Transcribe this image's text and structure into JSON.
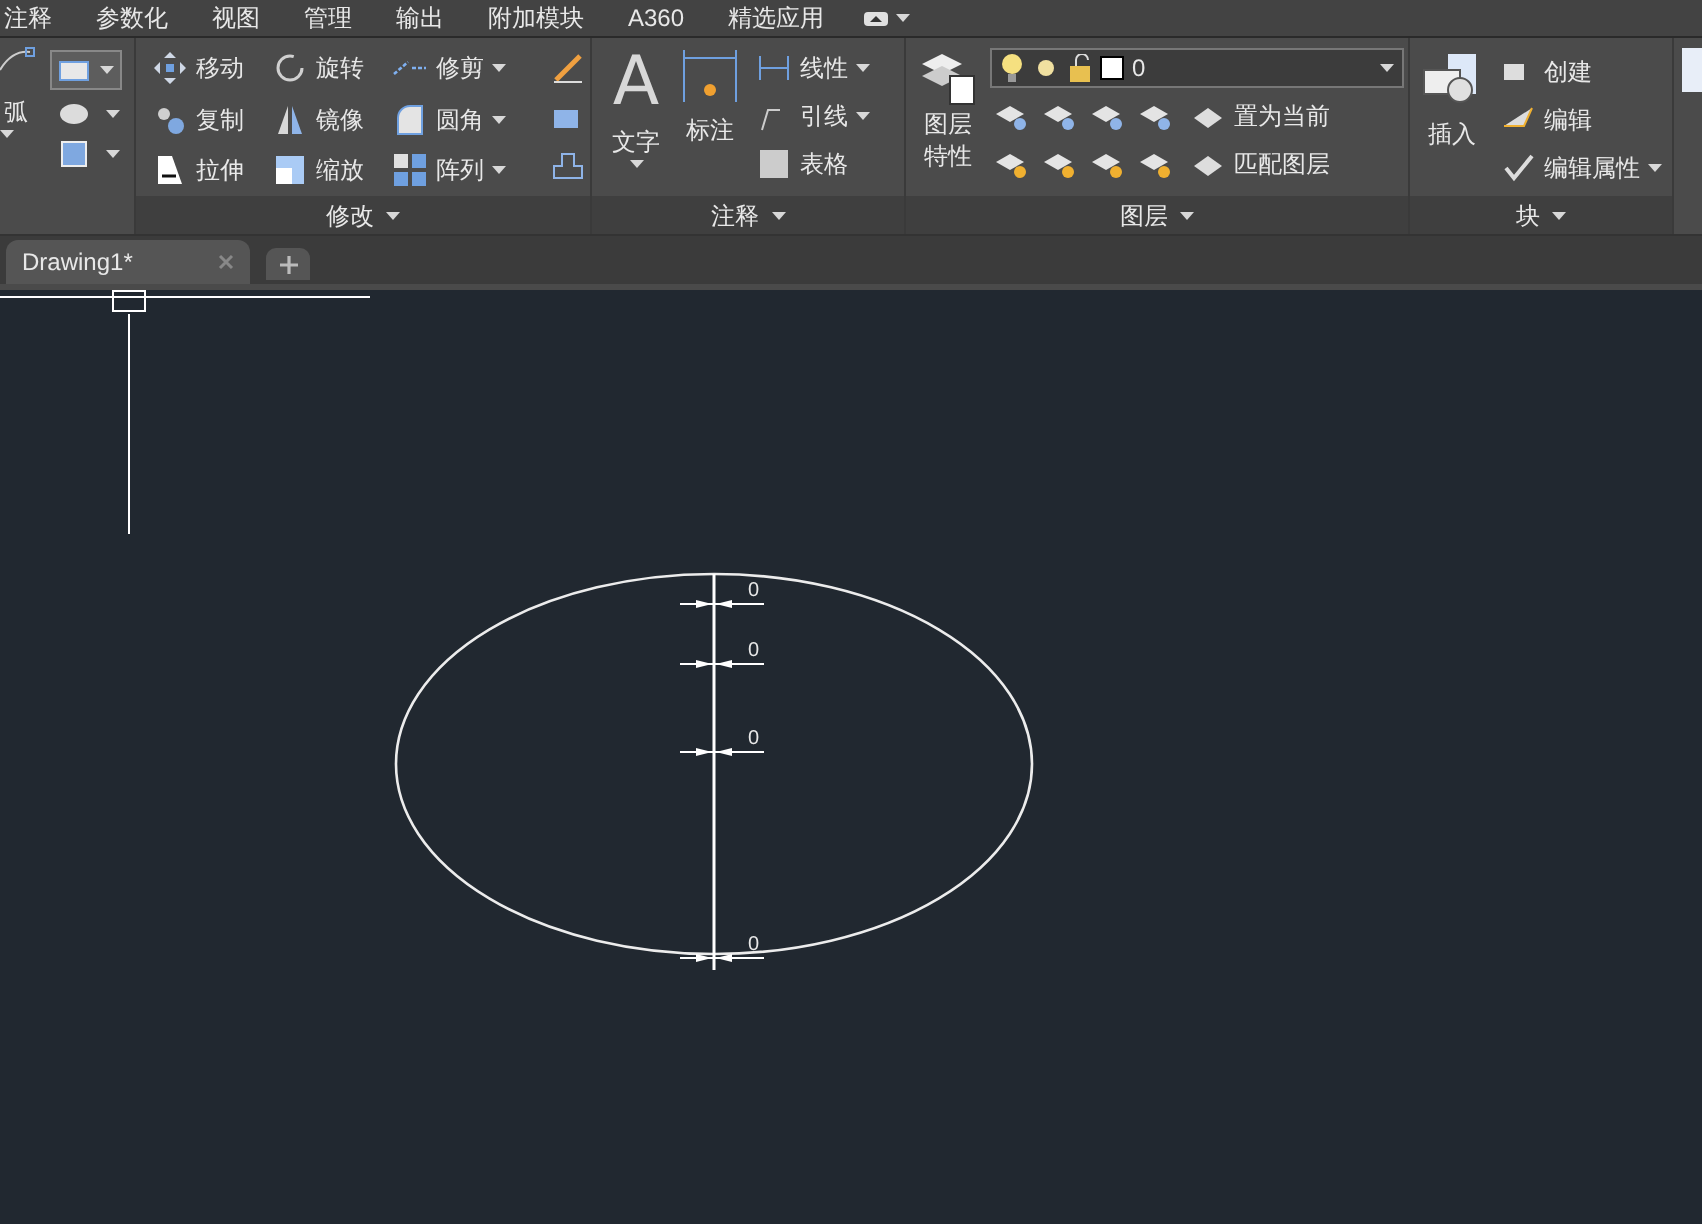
{
  "menu_bar": {
    "items": [
      "注释",
      "参数化",
      "视图",
      "管理",
      "输出",
      "附加模块",
      "A360",
      "精选应用"
    ]
  },
  "ribbon": {
    "draw_panel": {
      "label": "弧"
    },
    "modify_panel": {
      "title": "修改",
      "tools": [
        {
          "label": "移动",
          "has_menu": false
        },
        {
          "label": "旋转",
          "has_menu": false
        },
        {
          "label": "修剪",
          "has_menu": true
        },
        {
          "label": "复制",
          "has_menu": false
        },
        {
          "label": "镜像",
          "has_menu": false
        },
        {
          "label": "圆角",
          "has_menu": true
        },
        {
          "label": "拉伸",
          "has_menu": false
        },
        {
          "label": "缩放",
          "has_menu": false
        },
        {
          "label": "阵列",
          "has_menu": true
        }
      ]
    },
    "annotation_panel": {
      "title": "注释",
      "text_tool": "文字",
      "text_tool_glyph": "A",
      "dimension_tool": "标注",
      "tools": [
        {
          "label": "线性",
          "has_menu": true
        },
        {
          "label": "引线",
          "has_menu": true
        },
        {
          "label": "表格",
          "has_menu": false
        }
      ]
    },
    "layers_panel": {
      "title": "图层",
      "properties_tool": [
        "图层",
        "特性"
      ],
      "layer_value": "0",
      "tools": [
        {
          "label": "置为当前"
        },
        {
          "label": "匹配图层"
        }
      ]
    },
    "block_panel": {
      "title": "块",
      "insert_tool": "插入",
      "tools": [
        {
          "label": "创建",
          "has_menu": false
        },
        {
          "label": "编辑",
          "has_menu": false
        },
        {
          "label": "编辑属性",
          "has_menu": true
        }
      ]
    }
  },
  "document_tabs": [
    {
      "label": "Drawing1*",
      "selected": true
    }
  ],
  "canvas": {
    "dimension_labels": [
      "0",
      "0",
      "0",
      "0"
    ]
  }
}
